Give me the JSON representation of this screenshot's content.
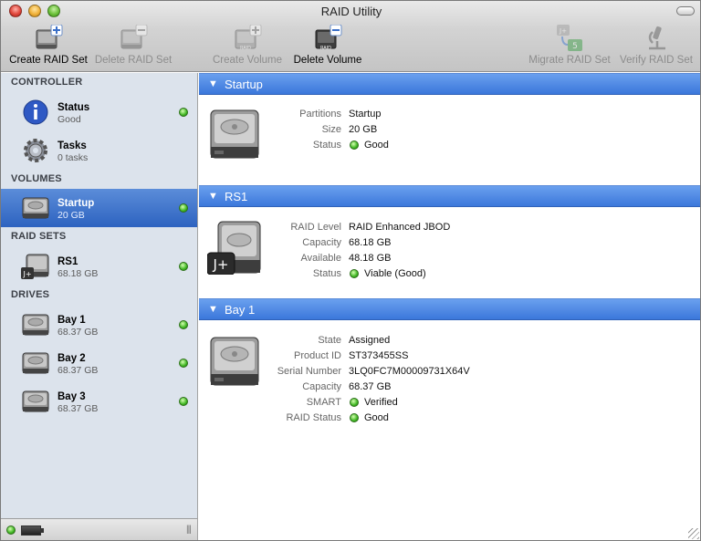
{
  "window": {
    "title": "RAID Utility"
  },
  "toolbar": {
    "create_raid_set": "Create RAID Set",
    "delete_raid_set": "Delete RAID Set",
    "create_volume": "Create Volume",
    "delete_volume": "Delete Volume",
    "migrate_raid_set": "Migrate RAID Set",
    "verify_raid_set": "Verify RAID Set"
  },
  "sidebar": {
    "controller": "CONTROLLER",
    "volumes": "VOLUMES",
    "raid_sets": "RAID SETS",
    "drives": "DRIVES",
    "status": {
      "name": "Status",
      "sub": "Good"
    },
    "tasks": {
      "name": "Tasks",
      "sub": "0 tasks"
    },
    "startup": {
      "name": "Startup",
      "sub": "20 GB"
    },
    "rs1": {
      "name": "RS1",
      "sub": "68.18 GB"
    },
    "bay1": {
      "name": "Bay 1",
      "sub": "68.37 GB"
    },
    "bay2": {
      "name": "Bay 2",
      "sub": "68.37 GB"
    },
    "bay3": {
      "name": "Bay 3",
      "sub": "68.37 GB"
    }
  },
  "startup": {
    "title": "Startup",
    "k_partitions": "Partitions",
    "v_partitions": "Startup",
    "k_size": "Size",
    "v_size": "20 GB",
    "k_status": "Status",
    "v_status": "Good"
  },
  "rs1": {
    "title": "RS1",
    "k_level": "RAID Level",
    "v_level": "RAID Enhanced JBOD",
    "k_capacity": "Capacity",
    "v_capacity": "68.18 GB",
    "k_available": "Available",
    "v_available": "48.18 GB",
    "k_status": "Status",
    "v_status": "Viable (Good)",
    "badge": "J+"
  },
  "bay1": {
    "title": "Bay 1",
    "k_state": "State",
    "v_state": "Assigned",
    "k_product": "Product ID",
    "v_product": "ST373455SS",
    "k_serial": "Serial Number",
    "v_serial": "3LQ0FC7M00009731X64V",
    "k_capacity": "Capacity",
    "v_capacity": "68.37 GB",
    "k_smart": "SMART",
    "v_smart": "Verified",
    "k_raid_status": "RAID Status",
    "v_raid_status": "Good"
  },
  "icons": {
    "raid_label": "RAID",
    "migrate_badge_top": "J+",
    "migrate_badge_bottom": "5"
  },
  "colors": {
    "selection": "#2d63c0",
    "header": "#3b77db",
    "status_ok": "#3fb623"
  }
}
